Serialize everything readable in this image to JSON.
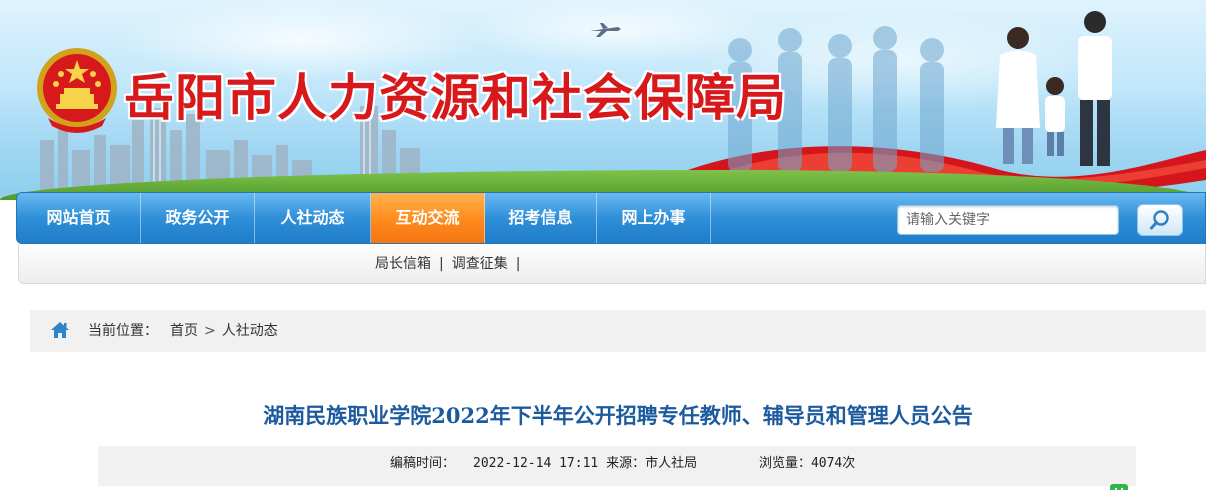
{
  "banner": {
    "site_title": "岳阳市人力资源和社会保障局"
  },
  "nav": {
    "items": [
      {
        "label": "网站首页",
        "active": false
      },
      {
        "label": "政务公开",
        "active": false
      },
      {
        "label": "人社动态",
        "active": false
      },
      {
        "label": "互动交流",
        "active": true
      },
      {
        "label": "招考信息",
        "active": false
      },
      {
        "label": "网上办事",
        "active": false
      }
    ],
    "search": {
      "placeholder": "请输入关键字",
      "button_icon": "search-icon"
    }
  },
  "subnav": {
    "links": [
      "局长信箱",
      "调查征集"
    ],
    "separator": "|"
  },
  "breadcrumb": {
    "label": "当前位置：",
    "items": [
      "首页",
      "人社动态"
    ],
    "arrow": ">"
  },
  "article": {
    "title": "湖南民族职业学院2022年下半年公开招聘专任教师、辅导员和管理人员公告",
    "meta": {
      "date_label": "编稿时间：",
      "date_value": "2022-12-14 17:11",
      "source_label": "来源：",
      "source_value": "市人社局",
      "views_label": "浏览量：",
      "views_value": "4074次"
    }
  },
  "colors": {
    "title_red": "#d7191c",
    "nav_blue": "#2f8fd8",
    "nav_active": "#ff8a1c",
    "article_title": "#1c5a9e"
  }
}
